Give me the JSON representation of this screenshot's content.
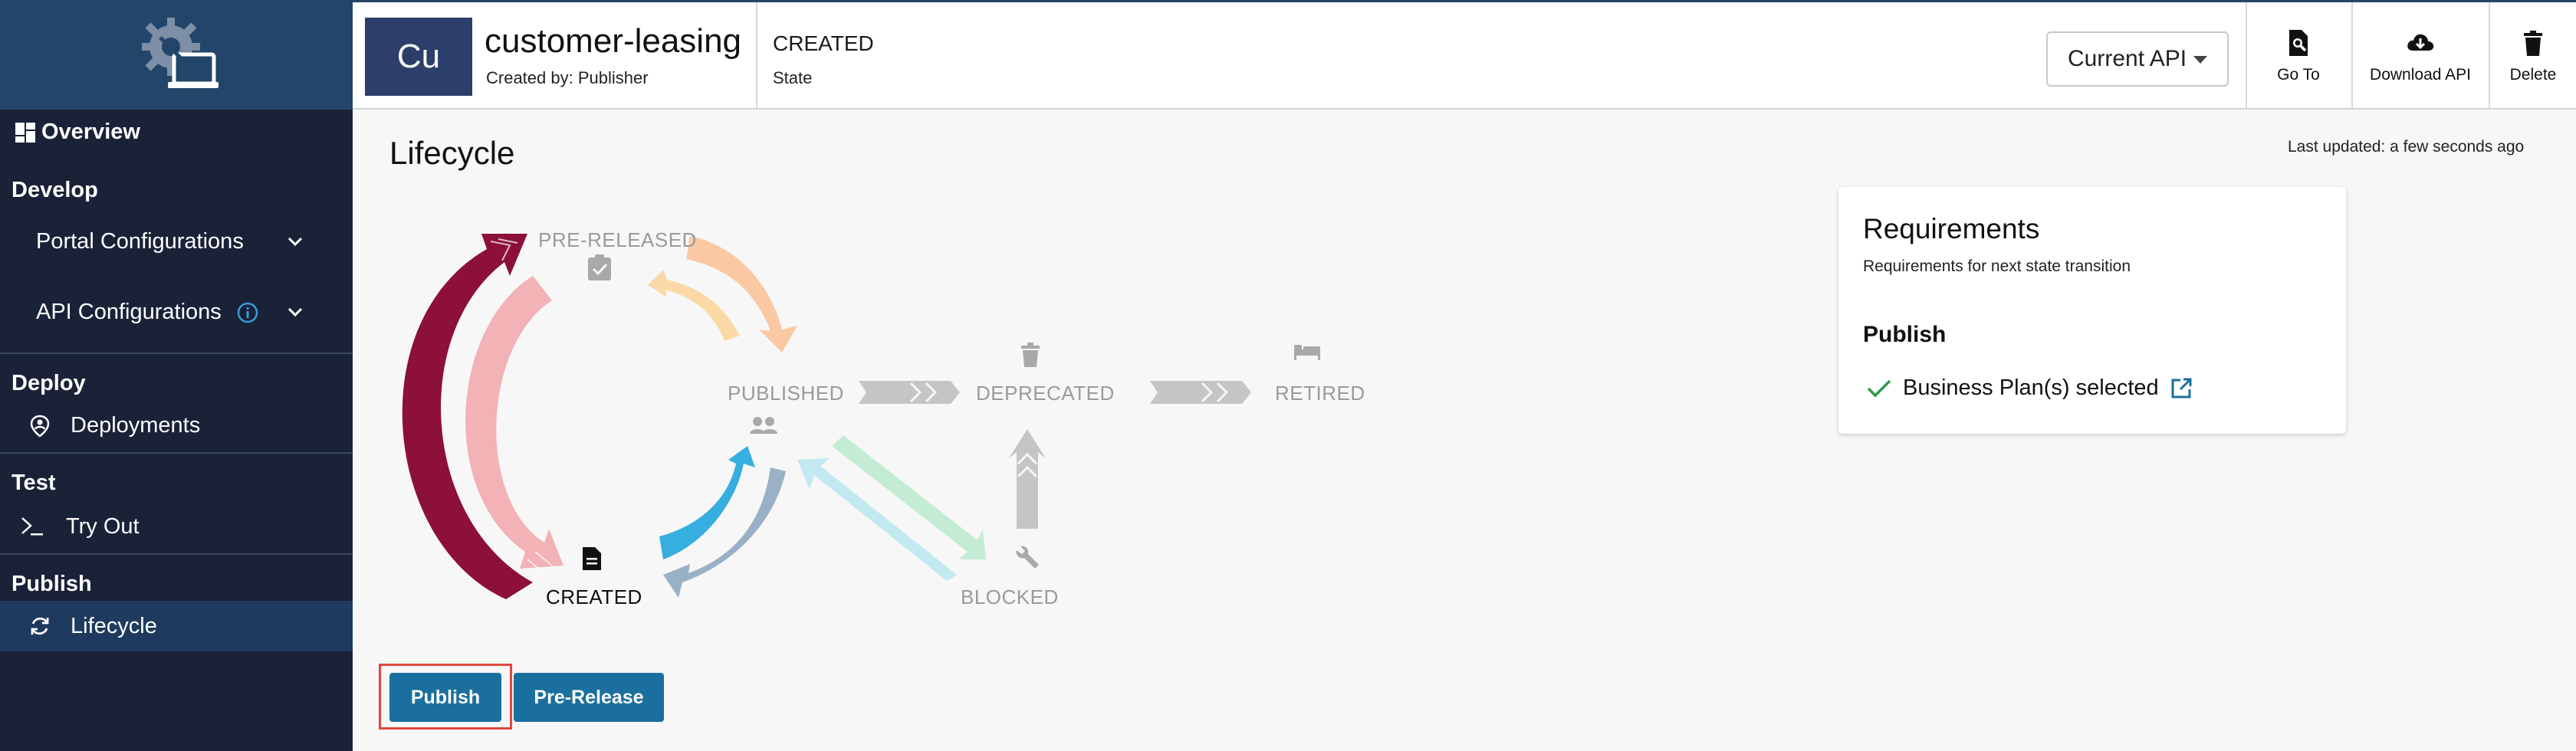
{
  "sidebar": {
    "logo_icon": "gear-laptop-logo-icon",
    "overview_label": "Overview",
    "sections": {
      "develop": "Develop",
      "deploy": "Deploy",
      "test": "Test",
      "publish": "Publish"
    },
    "items": {
      "portal_configurations": "Portal Configurations",
      "api_configurations": "API Configurations",
      "deployments": "Deployments",
      "try_out": "Try Out",
      "lifecycle": "Lifecycle"
    }
  },
  "header": {
    "avatar_text": "Cu",
    "api_name": "customer-leasing",
    "created_by": "Created by: Publisher",
    "state_value": "CREATED",
    "state_label": "State",
    "api_select_value": "Current API",
    "go_to_label": "Go To",
    "download_label": "Download API",
    "delete_label": "Delete"
  },
  "main": {
    "title": "Lifecycle",
    "last_updated": "Last updated: a few seconds ago"
  },
  "lifecycle": {
    "current_state": "CREATED",
    "states": {
      "pre_released": "PRE-RELEASED",
      "published": "PUBLISHED",
      "deprecated": "DEPRECATED",
      "retired": "RETIRED",
      "created": "CREATED",
      "blocked": "BLOCKED"
    },
    "colors": {
      "created_to_published_outer": "#8c1039",
      "created_to_published_inner": "#f3b2b6",
      "pre_to_pub_a": "#fbd9a6",
      "pre_to_pub_b": "#fac9a3",
      "created_pub_blue": "#37aee0",
      "created_pub_slate": "#9ab0c6",
      "blocked_green": "#c4ecd5",
      "blocked_cyan": "#c2e9ef",
      "gray_arrow": "#c5c5c5"
    }
  },
  "requirements": {
    "title": "Requirements",
    "subtitle": "Requirements for next state transition",
    "section": "Publish",
    "item": "Business Plan(s) selected",
    "check_color": "#2e9b4a",
    "link_color": "#1a6f9e"
  },
  "actions": {
    "publish": "Publish",
    "pre_release": "Pre-Release",
    "button_color": "#1a6f9e",
    "highlight_color": "#e0483e"
  }
}
